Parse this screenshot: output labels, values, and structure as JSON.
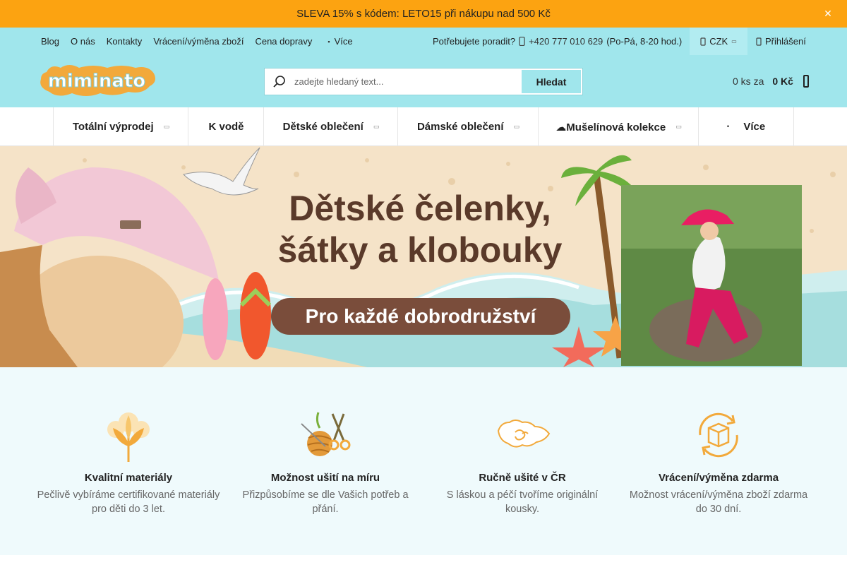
{
  "promo": {
    "text": "SLEVA 15% s kódem: LETO15 při nákupu nad 500 Kč",
    "close_icon": "close-icon"
  },
  "topnav": {
    "links": [
      "Blog",
      "O nás",
      "Kontakty",
      "Vrácení/výměna zboží",
      "Cena dopravy"
    ],
    "more_label": "Více",
    "help_label": "Potřebujete poradit?",
    "phone": "+420 777 010 629",
    "hours": "(Po-Pá, 8-20 hod.)",
    "currency": "CZK",
    "login": "Přihlášení"
  },
  "header": {
    "logo_text": "miminato",
    "search_placeholder": "zadejte hledaný text...",
    "search_button": "Hledat",
    "cart_count": "0 ks za",
    "cart_total": "0 Kč"
  },
  "categories": [
    {
      "label": "Totální výprodej",
      "icon": "tag-icon"
    },
    {
      "label": "K vodě",
      "icon": "water-icon"
    },
    {
      "label": "Dětské oblečení",
      "icon": "child-icon"
    },
    {
      "label": "Dámské oblečení",
      "icon": "woman-icon"
    },
    {
      "label": "☁Mušelínová kolekce",
      "icon": "cloud-icon"
    },
    {
      "label": "Více",
      "icon": "menu-icon"
    }
  ],
  "banner": {
    "headline_1": "Dětské čelenky,",
    "headline_2": "šátky a klobouky",
    "tagline": "Pro každé dobrodružství"
  },
  "features": [
    {
      "icon": "cotton-icon",
      "title": "Kvalitní materiály",
      "desc": "Pečlivě vybíráme certifikované materiály pro děti do 3 let."
    },
    {
      "icon": "sewing-icon",
      "title": "Možnost ušití na míru",
      "desc": "Přizpůsobíme se dle Vašich potřeb a přání."
    },
    {
      "icon": "czech-map-icon",
      "title": "Ručně ušité v ČR",
      "desc": "S láskou a péčí tvoříme originální kousky."
    },
    {
      "icon": "return-box-icon",
      "title": "Vrácení/výměna zdarma",
      "desc": "Možnost vrácení/výměna zboží zdarma do 30 dní."
    }
  ],
  "colors": {
    "promo": "#fca311",
    "header": "#a0e6ec",
    "brown": "#7a4d3b",
    "orange_icon": "#f2a93b"
  }
}
